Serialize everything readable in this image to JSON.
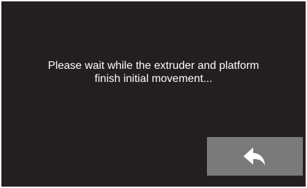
{
  "message": {
    "line1": "Please wait while the extruder and platform",
    "line2": "finish initial movement..."
  },
  "back_button": {
    "icon": "back-arrow-icon",
    "background": "#7a7a7a",
    "icon_color": "#ffffff"
  },
  "screen": {
    "background": "#231f20"
  }
}
